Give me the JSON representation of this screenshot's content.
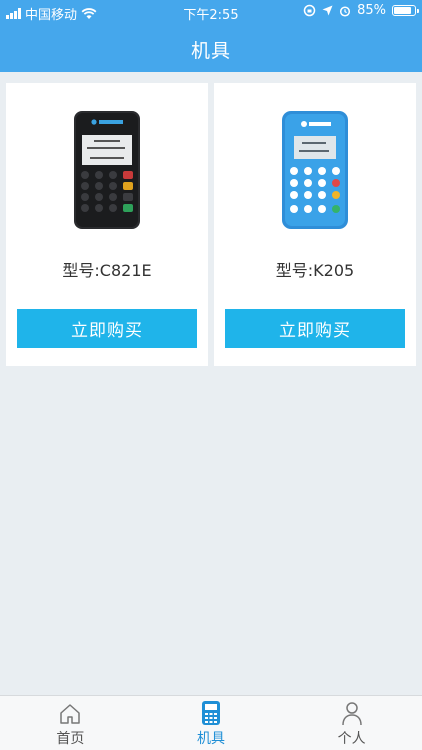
{
  "status_bar": {
    "carrier": "中国移动",
    "time": "下午2:55",
    "battery": "85%",
    "battery_level": 0.85
  },
  "header": {
    "title": "机具"
  },
  "products": [
    {
      "model": "型号:C821E",
      "buy_label": "立即购买",
      "device_icon": "black-pos-terminal"
    },
    {
      "model": "型号:K205",
      "buy_label": "立即购买",
      "device_icon": "blue-pos-terminal"
    }
  ],
  "tabbar": {
    "items": [
      {
        "label": "首页",
        "icon": "home-icon",
        "active": false
      },
      {
        "label": "机具",
        "icon": "pos-device-icon",
        "active": true
      },
      {
        "label": "个人",
        "icon": "person-icon",
        "active": false
      }
    ],
    "active_color": "#1f8fd6"
  },
  "colors": {
    "brand": "#45a7ec",
    "button": "#1fb4ea",
    "background": "#e9eef2"
  }
}
